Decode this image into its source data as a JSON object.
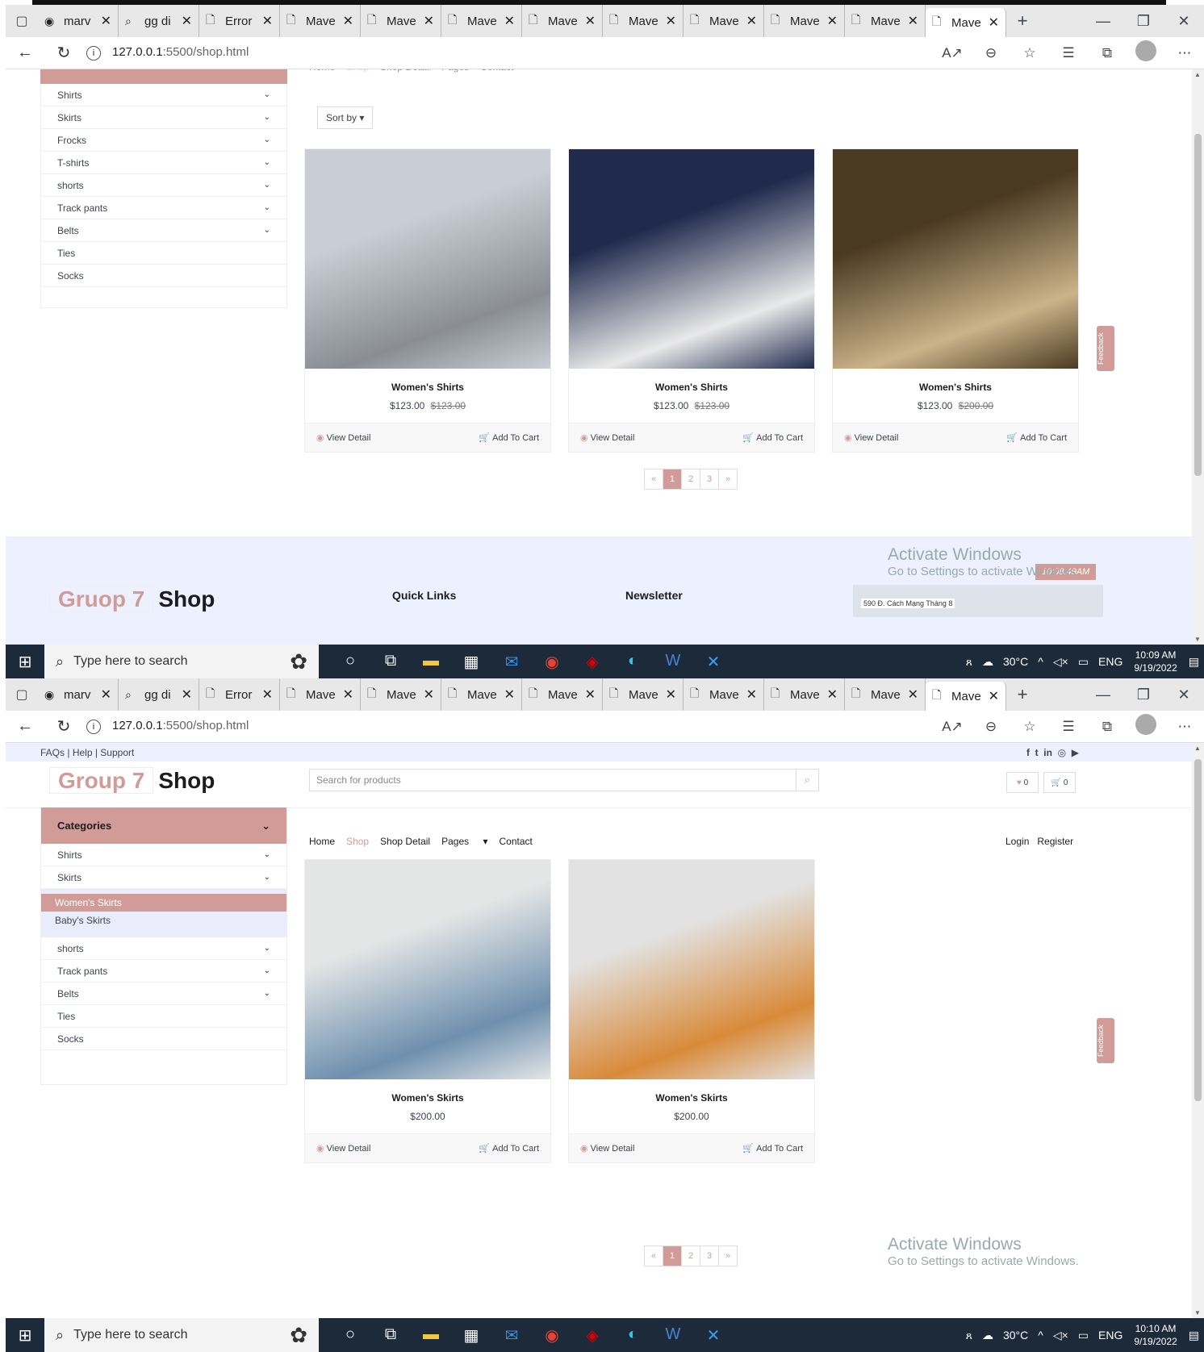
{
  "browser": {
    "tabs": [
      {
        "icon": "github-icon",
        "label": "marv"
      },
      {
        "icon": "search-icon",
        "label": "gg di"
      },
      {
        "icon": "page-icon",
        "label": "Error"
      },
      {
        "icon": "page-icon",
        "label": "Mave"
      },
      {
        "icon": "page-icon",
        "label": "Mave"
      },
      {
        "icon": "page-icon",
        "label": "Mave"
      },
      {
        "icon": "page-icon",
        "label": "Mave"
      },
      {
        "icon": "page-icon",
        "label": "Mave"
      },
      {
        "icon": "page-icon",
        "label": "Mave"
      },
      {
        "icon": "page-icon",
        "label": "Mave"
      },
      {
        "icon": "page-icon",
        "label": "Mave"
      }
    ],
    "url_host": "127.0.0.1",
    "url_path": ":5500/shop.html"
  },
  "taskbar": {
    "search_placeholder": "Type here to search",
    "weather": "30°C",
    "lang": "ENG",
    "clock1_time": "10:09 AM",
    "clock2_time": "10:10 AM",
    "date": "9/19/2022"
  },
  "topbar": {
    "faqs": "FAQs",
    "help": "Help",
    "support": "Support",
    "search_placeholder": "Search for products",
    "wishlist_count": "0",
    "cart_count": "0"
  },
  "logo": {
    "part1": "Group 7",
    "part2": "Shop",
    "footer_part1": "Gruop 7"
  },
  "nav": {
    "items": [
      "Home",
      "Shop",
      "Shop Detail",
      "Pages",
      "Contact"
    ],
    "login": "Login",
    "register": "Register"
  },
  "categories": {
    "title": "Categories",
    "list1": [
      "Shirts",
      "Skirts",
      "Frocks",
      "T-shirts",
      "shorts",
      "Track pants",
      "Belts",
      "Ties",
      "Socks"
    ],
    "list2_top": [
      "Shirts",
      "Skirts"
    ],
    "skirts_sub": [
      "Women's Skirts",
      "Baby's Skirts"
    ],
    "list2_bottom": [
      "shorts",
      "Track pants",
      "Belts",
      "Ties",
      "Socks"
    ]
  },
  "sort_label": "Sort by",
  "products1": [
    {
      "name": "Women's Shirts",
      "price": "$123.00",
      "old_price": "$123.00",
      "colors": [
        "#c9ced6",
        "#8a8d94"
      ]
    },
    {
      "name": "Women's Shirts",
      "price": "$123.00",
      "old_price": "$123.00",
      "colors": [
        "#1f2a4d",
        "#e9e9e9"
      ]
    },
    {
      "name": "Women's Shirts",
      "price": "$123.00",
      "old_price": "$200.00",
      "colors": [
        "#4a3a22",
        "#cbb389"
      ]
    }
  ],
  "products2": [
    {
      "name": "Women's Skirts",
      "price": "$200.00",
      "colors": [
        "#e4e6e6",
        "#6e8fae"
      ]
    },
    {
      "name": "Women's Skirts",
      "price": "$200.00",
      "colors": [
        "#e2e2e2",
        "#d98a3a"
      ]
    }
  ],
  "card_actions": {
    "view": "View Detail",
    "cart": "Add To Cart"
  },
  "pagination": [
    "«",
    "1",
    "2",
    "3",
    "»"
  ],
  "feedback": "Feedback",
  "footer": {
    "quick_links": "Quick Links",
    "newsletter": "Newsletter",
    "map_address": "590 Đ. Cách Mạng Tháng 8",
    "timestamp": "10:08:49AM"
  },
  "activate": {
    "line1": "Activate Windows",
    "line2": "Go to Settings to activate Windows."
  },
  "colors": {
    "accent": "#d19c97",
    "dark": "#1c1c1c",
    "light": "#edf1ff"
  }
}
